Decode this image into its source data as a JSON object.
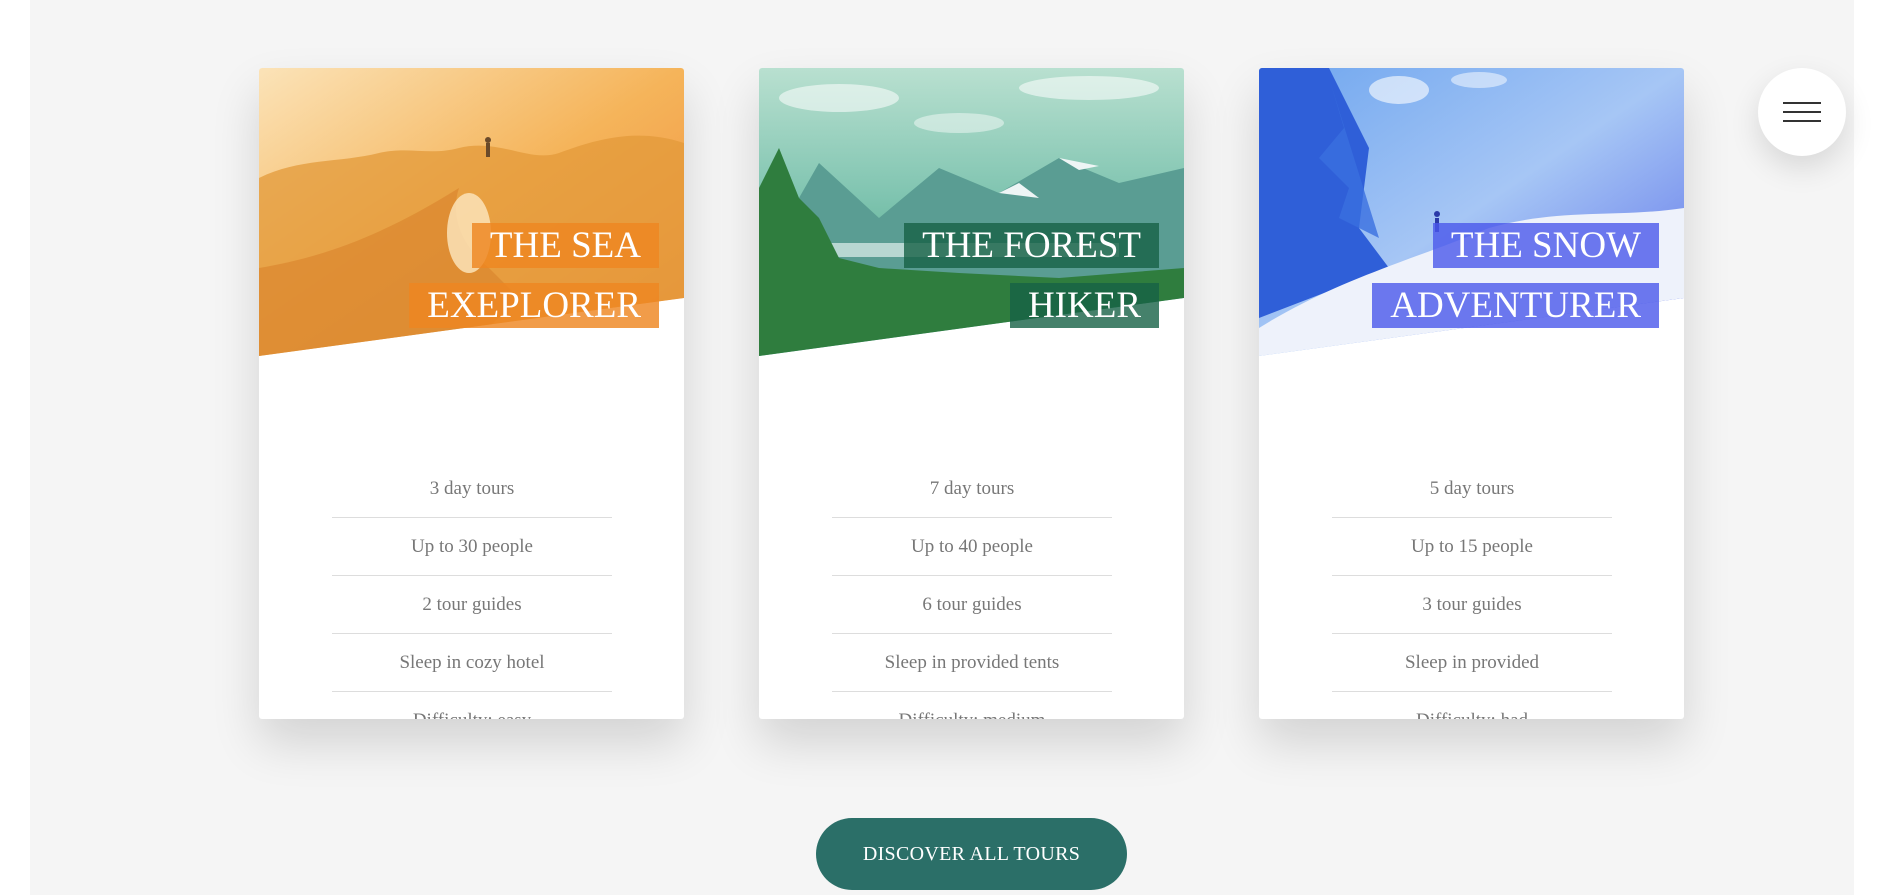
{
  "menu": {
    "icon": "hamburger-menu-icon"
  },
  "tours": [
    {
      "heading_line1": "THE SEA",
      "heading_line2": "EXEPLORER",
      "image": "sea-explorer-photo",
      "accent": "#ee8621",
      "details": [
        "3 day tours",
        "Up to 30 people",
        "2 tour guides",
        "Sleep in cozy hotel",
        "Difficulty: easy"
      ]
    },
    {
      "heading_line1": "THE FOREST",
      "heading_line2": "HIKER",
      "image": "forest-hiker-photo",
      "accent": "#166146",
      "details": [
        "7 day tours",
        "Up to 40 people",
        "6 tour guides",
        "Sleep in provided tents",
        "Difficulty: medium"
      ]
    },
    {
      "heading_line1": "THE SNOW",
      "heading_line2": "ADVENTURER",
      "image": "snow-adventurer-photo",
      "accent": "#4a58eb",
      "details": [
        "5 day tours",
        "Up to 15 people",
        "3 tour guides",
        "Sleep in provided",
        "Difficulty: had"
      ]
    }
  ],
  "cta": {
    "label": "DISCOVER ALL TOURS",
    "color": "#2b6f68"
  }
}
